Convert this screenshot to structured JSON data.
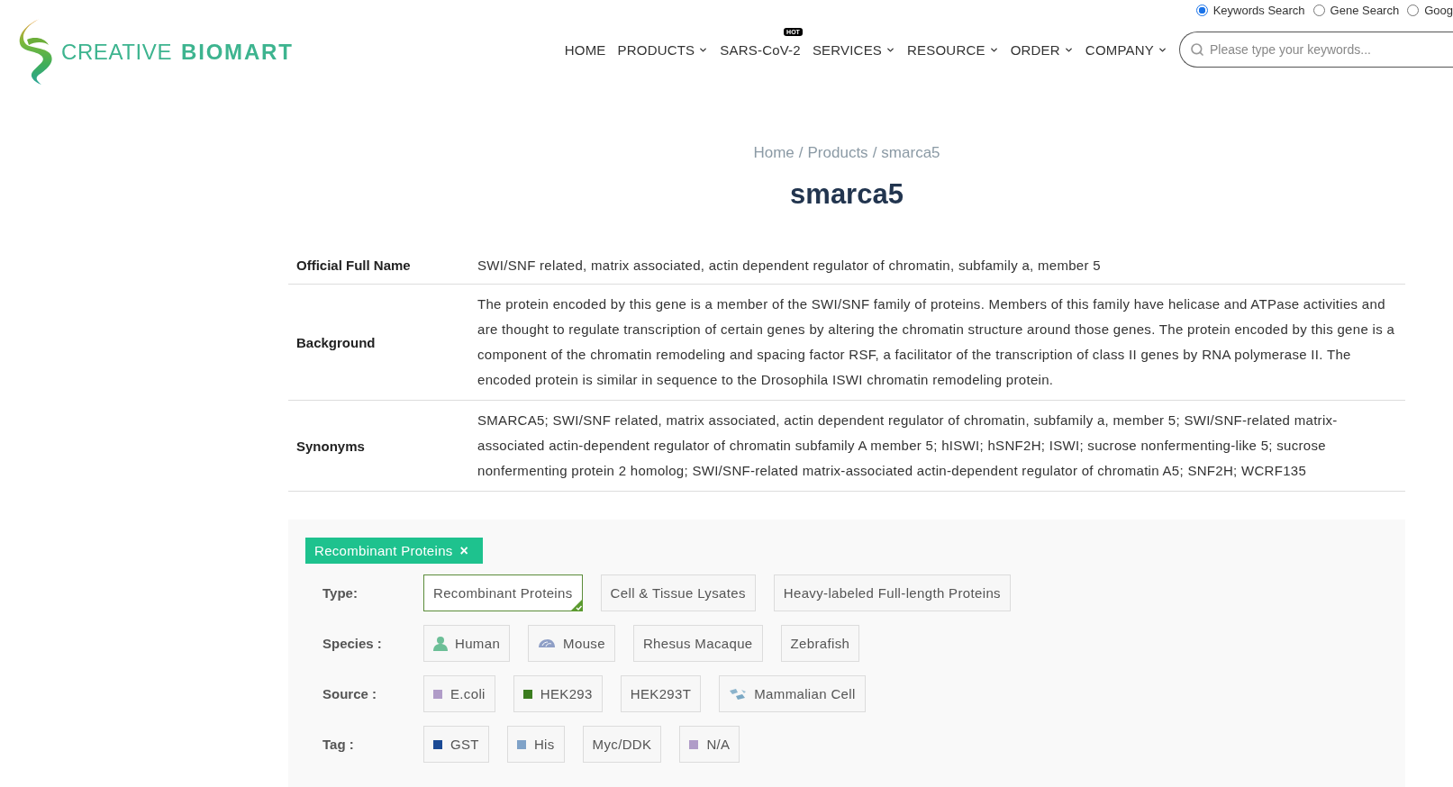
{
  "header": {
    "logo": {
      "word_1": "CREATIVE",
      "word_2": "BIOMART"
    },
    "search_modes": [
      {
        "label": "Keywords Search",
        "selected": true
      },
      {
        "label": "Gene Search",
        "selected": false
      },
      {
        "label": "Goog",
        "selected": false
      }
    ],
    "nav": [
      {
        "label": "HOME",
        "dropdown": false
      },
      {
        "label": "PRODUCTS",
        "dropdown": true
      },
      {
        "label": "SARS-CoV-2",
        "dropdown": false,
        "badge": "HOT"
      },
      {
        "label": "SERVICES",
        "dropdown": true
      },
      {
        "label": "RESOURCE",
        "dropdown": true
      },
      {
        "label": "ORDER",
        "dropdown": true
      },
      {
        "label": "COMPANY",
        "dropdown": true
      }
    ],
    "search": {
      "placeholder": "Please type your keywords..."
    }
  },
  "breadcrumb": {
    "separator": "/",
    "items": [
      "Home",
      "Products",
      "smarca5"
    ]
  },
  "title": "smarca5",
  "details": [
    {
      "label": "Official Full Name",
      "value": "SWI/SNF related, matrix associated, actin dependent regulator of chromatin, subfamily a, member 5"
    },
    {
      "label": "Background",
      "value": "The protein encoded by this gene is a member of the SWI/SNF family of proteins. Members of this family have helicase and ATPase activities and are thought to regulate transcription of certain genes by altering the chromatin structure around those genes. The protein encoded by this gene is a component of the chromatin remodeling and spacing factor RSF, a facilitator of the transcription of class II genes by RNA polymerase II. The encoded protein is similar in sequence to the Drosophila ISWI chromatin remodeling protein."
    },
    {
      "label": "Synonyms",
      "value": "SMARCA5; SWI/SNF related, matrix associated, actin dependent regulator of chromatin, subfamily a, member 5; SWI/SNF-related matrix-associated actin-dependent regulator of chromatin subfamily A member 5; hISWI; hSNF2H; ISWI; sucrose nonfermenting-like 5; sucrose nonfermenting protein 2 homolog; SWI/SNF-related matrix-associated actin-dependent regulator of chromatin A5; SNF2H; WCRF135"
    }
  ],
  "filter": {
    "active_tags": [
      {
        "label": "Recombinant Proteins",
        "remove": "×"
      }
    ],
    "groups": [
      {
        "label": "Type:",
        "options": [
          {
            "label": "Recombinant Proteins",
            "kind": "plain",
            "selected": true
          },
          {
            "label": "Cell & Tissue Lysates",
            "kind": "plain",
            "selected": false
          },
          {
            "label": "Heavy-labeled Full-length Proteins",
            "kind": "plain",
            "selected": false
          }
        ]
      },
      {
        "label": "Species :",
        "options": [
          {
            "label": "Human",
            "kind": "person",
            "selected": false
          },
          {
            "label": "Mouse",
            "kind": "mouse",
            "selected": false
          },
          {
            "label": "Rhesus Macaque",
            "kind": "plain",
            "selected": false
          },
          {
            "label": "Zebrafish",
            "kind": "plain",
            "selected": false
          }
        ]
      },
      {
        "label": "Source :",
        "options": [
          {
            "label": "E.coli",
            "kind": "swatch",
            "color": "#b09cc8",
            "selected": false
          },
          {
            "label": "HEK293",
            "kind": "swatch",
            "color": "#3b7d1f",
            "selected": false
          },
          {
            "label": "HEK293T",
            "kind": "plain",
            "selected": false
          },
          {
            "label": "Mammalian Cell",
            "kind": "cells",
            "selected": false
          }
        ]
      },
      {
        "label": "Tag :",
        "options": [
          {
            "label": "GST",
            "kind": "swatch",
            "color": "#1b4a95",
            "selected": false
          },
          {
            "label": "His",
            "kind": "swatch",
            "color": "#7fa2c8",
            "selected": false
          },
          {
            "label": "Myc/DDK",
            "kind": "plain",
            "selected": false
          },
          {
            "label": "N/A",
            "kind": "swatch",
            "color": "#b09cc8",
            "selected": false
          }
        ]
      }
    ]
  }
}
